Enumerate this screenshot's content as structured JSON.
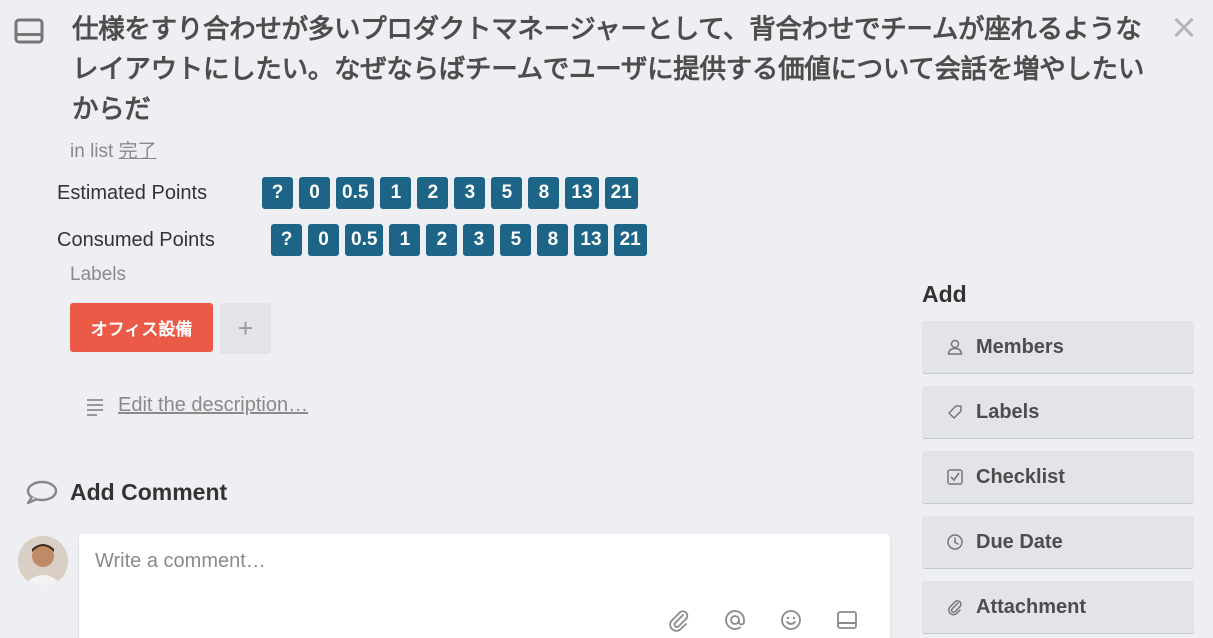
{
  "card": {
    "title": "仕様をすり合わせが多いプロダクトマネージャーとして、背合わせでチームが座れるようなレイアウトにしたい。なぜならばチームでユーザに提供する価値について会話を増やしたいからだ",
    "close_glyph": "×",
    "in_list_prefix": "in list",
    "list_name": "完了"
  },
  "estimated": {
    "label": "Estimated Points",
    "values": [
      "?",
      "0",
      "0.5",
      "1",
      "2",
      "3",
      "5",
      "8",
      "13",
      "21"
    ]
  },
  "consumed": {
    "label": "Consumed Points",
    "values": [
      "?",
      "0",
      "0.5",
      "1",
      "2",
      "3",
      "5",
      "8",
      "13",
      "21"
    ]
  },
  "labels": {
    "heading": "Labels",
    "items": [
      {
        "text": "オフィス設備",
        "color": "#eb5a46"
      }
    ],
    "add_glyph": "+"
  },
  "description": {
    "link": "Edit the description…"
  },
  "comment": {
    "heading": "Add Comment",
    "placeholder": "Write a comment…",
    "tools": [
      "attachment-icon",
      "mention-icon",
      "emoji-icon",
      "card-icon"
    ]
  },
  "sidebar": {
    "heading": "Add",
    "buttons": [
      {
        "label": "Members",
        "icon": "person-icon"
      },
      {
        "label": "Labels",
        "icon": "tag-icon"
      },
      {
        "label": "Checklist",
        "icon": "checkbox-icon"
      },
      {
        "label": "Due Date",
        "icon": "clock-icon"
      },
      {
        "label": "Attachment",
        "icon": "paperclip-icon"
      }
    ]
  },
  "colors": {
    "chip": "#1c6587",
    "label_red": "#eb5a46",
    "background": "#edeff3"
  }
}
